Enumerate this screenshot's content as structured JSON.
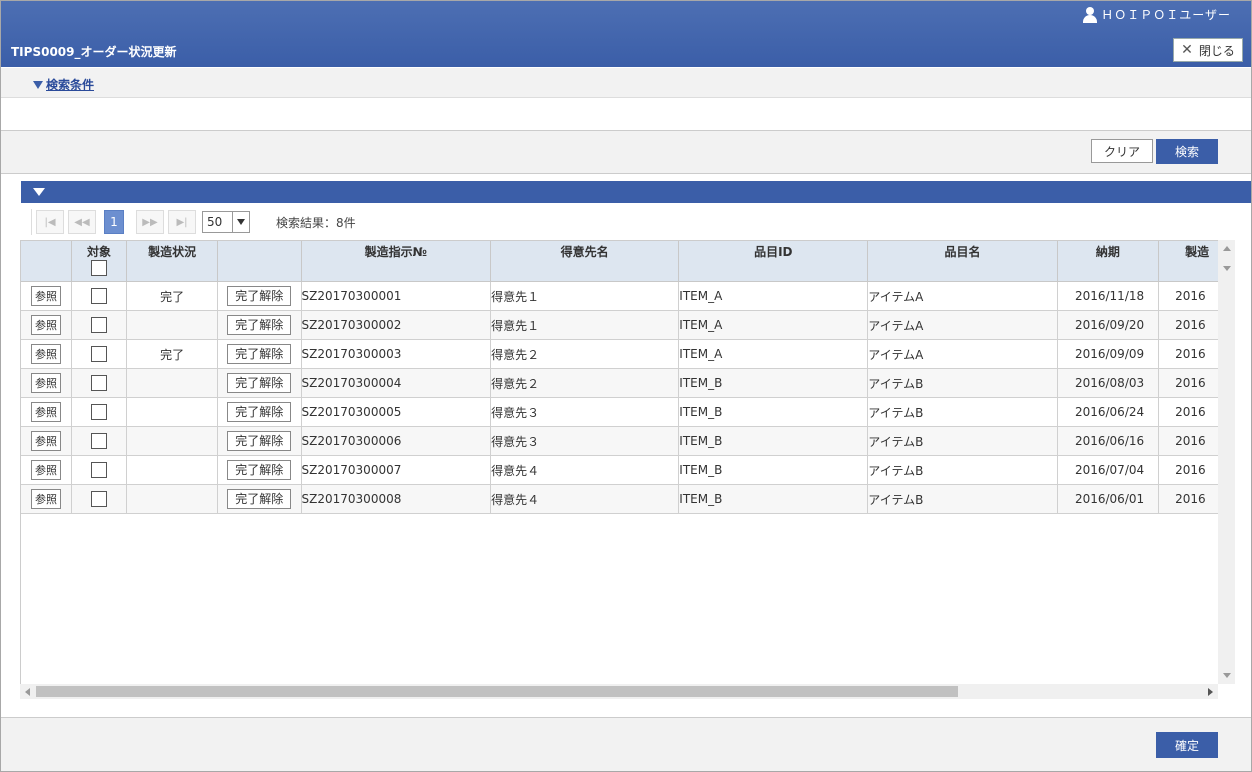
{
  "header": {
    "user_label": "ＨＯＩＰＯＩユーザー",
    "title": "TIPS0009_オーダー状況更新",
    "close_label": "閉じる"
  },
  "search": {
    "toggle_label": "検索条件",
    "clear_label": "クリア",
    "search_label": "検索"
  },
  "pager": {
    "first": "⏮",
    "prev": "◀◀",
    "page": "1",
    "next": "▶▶",
    "last": "▶|",
    "page_size": "50",
    "result_count": "検索結果：8件"
  },
  "table": {
    "columns": [
      "",
      "対象",
      "製造状況",
      "",
      "製造指示№",
      "得意先名",
      "品目ID",
      "品目名",
      "納期",
      "製造"
    ],
    "ref_label": "参照",
    "release_label": "完了解除",
    "rows": [
      {
        "status": "完了",
        "order_no": "SZ20170300001",
        "customer": "得意先１",
        "item_id": "ITEM_A",
        "item_name": "アイテムA",
        "due": "2016/11/18",
        "extra": "2016"
      },
      {
        "status": "",
        "order_no": "SZ20170300002",
        "customer": "得意先１",
        "item_id": "ITEM_A",
        "item_name": "アイテムA",
        "due": "2016/09/20",
        "extra": "2016"
      },
      {
        "status": "完了",
        "order_no": "SZ20170300003",
        "customer": "得意先２",
        "item_id": "ITEM_A",
        "item_name": "アイテムA",
        "due": "2016/09/09",
        "extra": "2016"
      },
      {
        "status": "",
        "order_no": "SZ20170300004",
        "customer": "得意先２",
        "item_id": "ITEM_B",
        "item_name": "アイテムB",
        "due": "2016/08/03",
        "extra": "2016"
      },
      {
        "status": "",
        "order_no": "SZ20170300005",
        "customer": "得意先３",
        "item_id": "ITEM_B",
        "item_name": "アイテムB",
        "due": "2016/06/24",
        "extra": "2016"
      },
      {
        "status": "",
        "order_no": "SZ20170300006",
        "customer": "得意先３",
        "item_id": "ITEM_B",
        "item_name": "アイテムB",
        "due": "2016/06/16",
        "extra": "2016"
      },
      {
        "status": "",
        "order_no": "SZ20170300007",
        "customer": "得意先４",
        "item_id": "ITEM_B",
        "item_name": "アイテムB",
        "due": "2016/07/04",
        "extra": "2016"
      },
      {
        "status": "",
        "order_no": "SZ20170300008",
        "customer": "得意先４",
        "item_id": "ITEM_B",
        "item_name": "アイテムB",
        "due": "2016/06/01",
        "extra": "2016"
      }
    ]
  },
  "footer": {
    "confirm_label": "確定"
  }
}
